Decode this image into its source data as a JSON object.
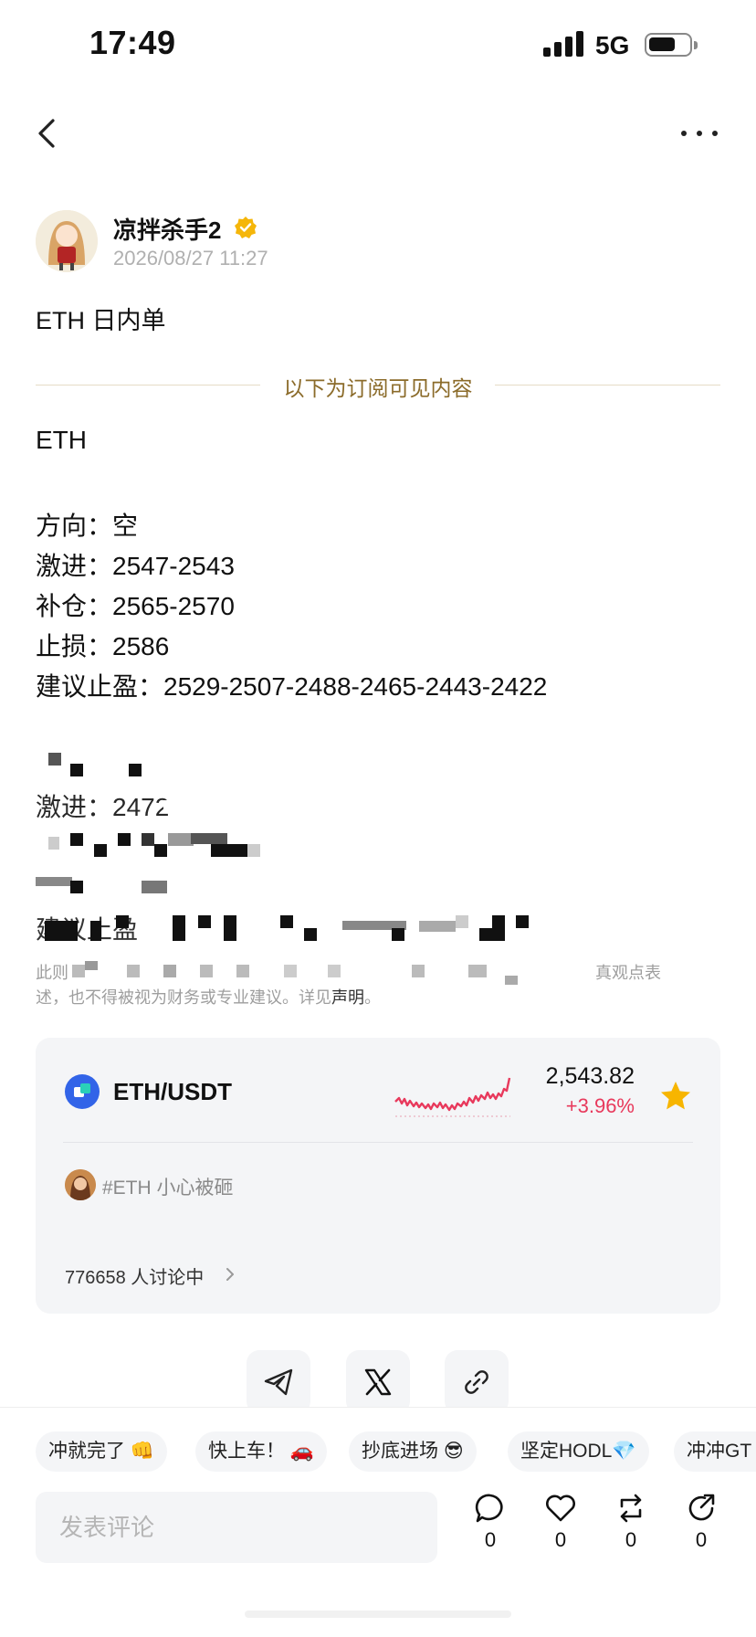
{
  "status_bar": {
    "time": "17:49",
    "network": "5G"
  },
  "author": {
    "name": "凉拌杀手2",
    "timestamp": "2026/08/27 11:27",
    "verified": true
  },
  "post": {
    "title": "ETH 日内单",
    "subscription_divider": "以下为订阅可见内容",
    "lines": [
      "ETH",
      "方向：空",
      "激进：2547-2543",
      "补仓：2565-2570",
      "止损：2586",
      "建议止盈：2529-2507-2488-2465-2443-2422"
    ],
    "blurred_fragments": [
      "激进：2472",
      "建议止盈"
    ],
    "disclaimer_prefix": "此则",
    "disclaimer_suffix": "述，也不得被视为财务或专业建议。详见",
    "disclaimer_tail_visible": "真观点表",
    "disclaimer_link": "声明",
    "disclaimer_end": "。"
  },
  "market_card": {
    "pair": "ETH/USDT",
    "price": "2,543.82",
    "change": "+3.96%",
    "change_color": "#e8395c",
    "favorited": true,
    "tag": "#ETH 小心被砸",
    "discussion": "776658 人讨论中"
  },
  "share": [
    "telegram-icon",
    "x-icon",
    "link-icon"
  ],
  "quick_replies": [
    "冲就完了 👊",
    "快上车！ 🚗",
    "抄底进场 😎",
    "坚定HODL💎",
    "冲冲GT"
  ],
  "comment": {
    "placeholder": "发表评论"
  },
  "actions": [
    {
      "name": "comment",
      "count": "0"
    },
    {
      "name": "like",
      "count": "0"
    },
    {
      "name": "repost",
      "count": "0"
    },
    {
      "name": "share",
      "count": "0"
    }
  ]
}
